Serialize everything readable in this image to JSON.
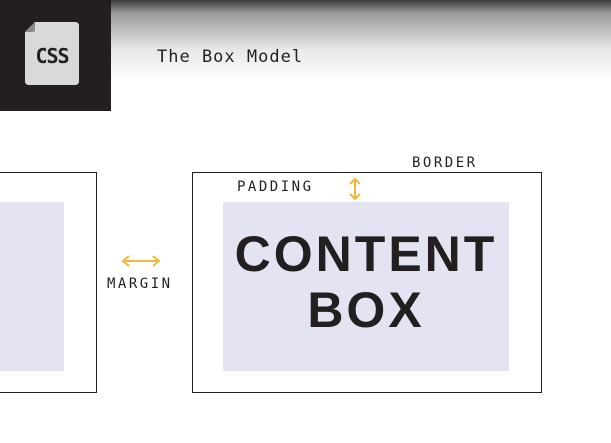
{
  "header": {
    "logo_label": "CSS",
    "title": "The Box Model"
  },
  "diagram": {
    "border_label": "BORDER",
    "padding_label": "PADDING",
    "margin_label": "MARGIN",
    "content_lines": [
      "CONTENT",
      "BOX"
    ]
  },
  "colors": {
    "dark": "#231f20",
    "content_fill": "#e4e3f1",
    "arrow": "#f2b63a"
  },
  "icons": {
    "logo": "css-file-icon",
    "margin_arrow": "horizontal-double-arrow-icon",
    "padding_arrow": "vertical-double-arrow-icon"
  }
}
